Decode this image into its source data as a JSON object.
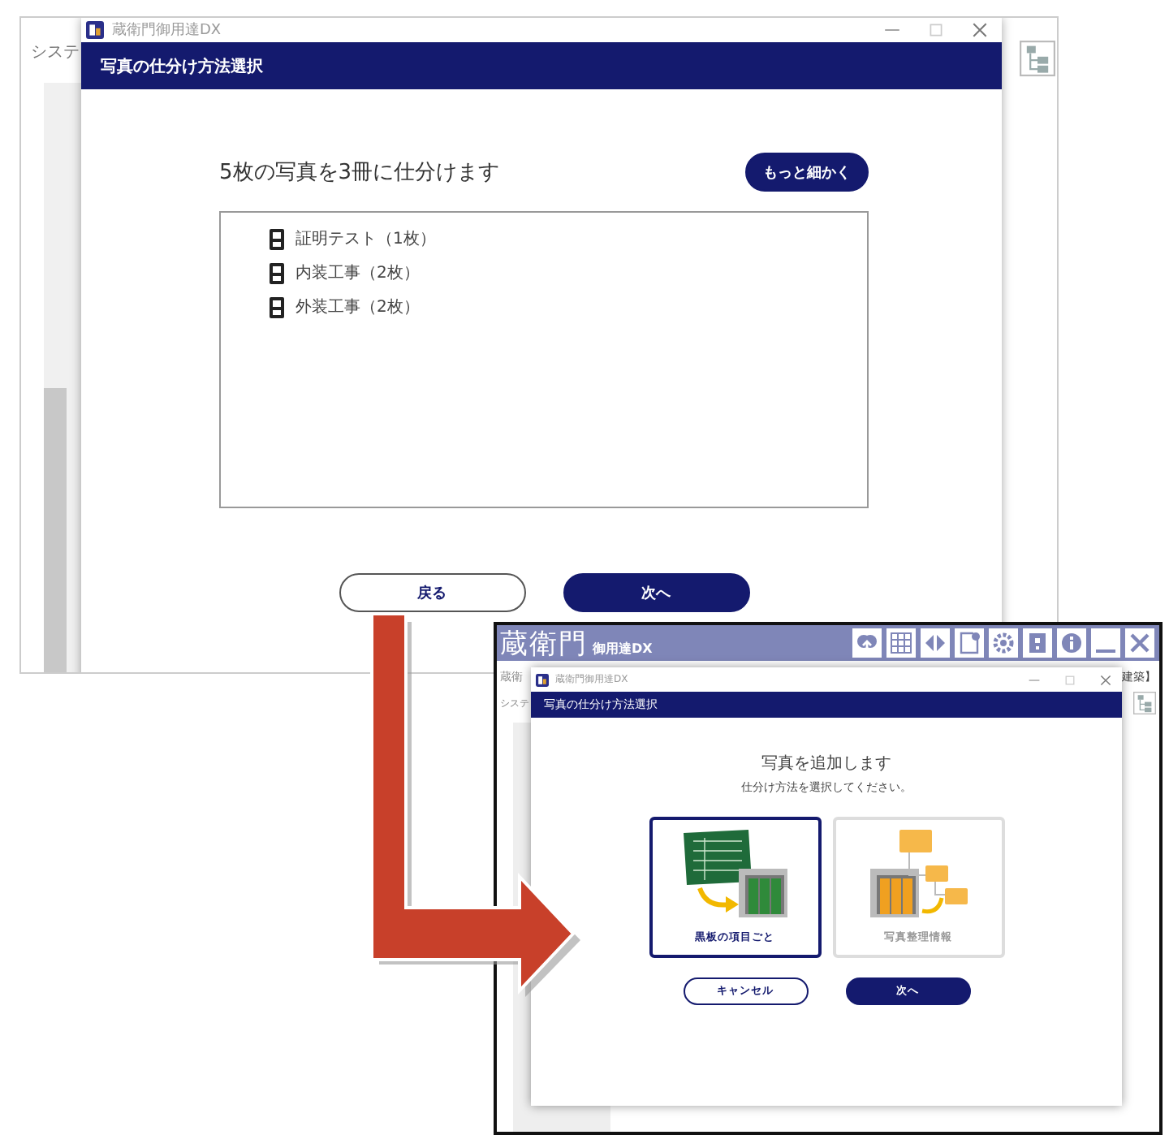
{
  "screenshot_1": {
    "background_app": {
      "menu_label": "システ"
    },
    "dialog": {
      "app_title": "蔵衛門御用達DX",
      "title": "写真の仕分け方法選択",
      "heading": "5枚の写真を3冊に仕分けます",
      "finer_button": "もっと細かく",
      "albums": [
        {
          "label": "証明テスト（1枚）"
        },
        {
          "label": "内装工事（2枚）"
        },
        {
          "label": "外装工事（2枚）"
        }
      ],
      "buttons": [
        {
          "label": "戻る",
          "kind": "secondary"
        },
        {
          "label": "次へ",
          "kind": "primary"
        }
      ]
    }
  },
  "screenshot_2": {
    "app": {
      "logo": "蔵衛門",
      "logo_suffix": "御用達DX",
      "background_title": "蔵衛",
      "background_tag": "建築】",
      "menu_label": "システ"
    },
    "dialog": {
      "app_title": "蔵衛門御用達DX",
      "title": "写真の仕分け方法選択",
      "heading": "写真を追加します",
      "subheading": "仕分け方法を選択してください。",
      "options": [
        {
          "label": "黒板の項目ごと",
          "selected": true,
          "kind": "blackboard"
        },
        {
          "label": "写真整理情報",
          "selected": false,
          "kind": "folders"
        }
      ],
      "buttons": [
        {
          "label": "キャンセル",
          "kind": "secondary"
        },
        {
          "label": "次へ",
          "kind": "primary"
        }
      ]
    }
  }
}
